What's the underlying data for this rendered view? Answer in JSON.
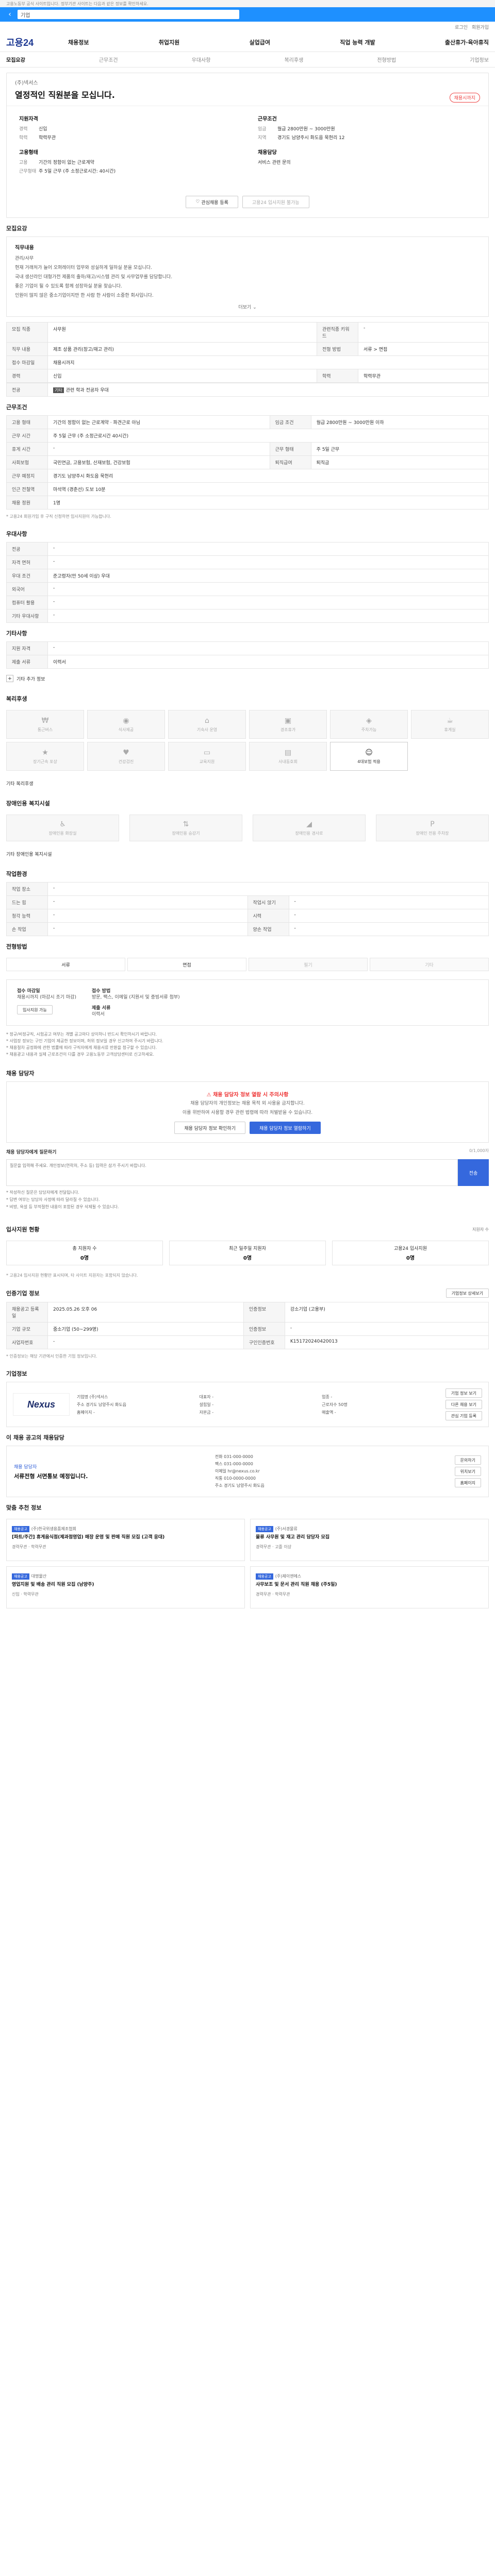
{
  "banner": "고용노동부 공식 사이트입니다. 정부기관 사이트는 다음과 같은 정보를 확인하세요.",
  "search": {
    "placeholder": "기업"
  },
  "top_links": [
    "로그인",
    "회원가입"
  ],
  "logo": "고용24",
  "gnb": [
    "채용정보",
    "취업지원",
    "실업급여",
    "직업 능력 개발",
    "출산휴가·육아휴직"
  ],
  "tabs": [
    "모집요강",
    "근무조건",
    "우대사항",
    "복리후생",
    "전형방법",
    "기업정보"
  ],
  "job": {
    "company": "(주)넥서스",
    "title": "열정적인 직원분을 모십니다.",
    "badge": "채용시까지"
  },
  "summary": {
    "qualifications_title": "지원자격",
    "career_k": "경력",
    "career_v": "신입",
    "education_k": "학력",
    "education_v": "학력무관",
    "conditions_title": "고용형태",
    "employment_k": "고용",
    "employment_v": "기간의 정함이 없는 근로계약",
    "worktype_k": "근무형태",
    "worktype_v": "주 5일 근무 (주 소정근로시간: 40시간)",
    "wage_title": "근무조건",
    "wage_k": "임금",
    "wage_v": "월급 2800만원 ~ 3000만원",
    "area_k": "지역",
    "area_v": "경기도 남양주시 화도읍 묵현리 12",
    "agency_title": "채용담당",
    "agency_v": "서비스 관련 문의",
    "btn_interest": "관심채용 등록",
    "btn_apply": "고용24 입사지원 불가능"
  },
  "recruit_title": "모집요강",
  "duties": {
    "heading": "직무내용",
    "sub": "관리/사무",
    "lines": [
      "현재 거래처가 늘어 오퍼레이터 업무와 성실하게 일하실 분을 모십니다.",
      "국내 생산라인 대형가전 제품의 출하/재고/시스템 관리 및 사무업무를 담당합니다.",
      "좋은 기업이 될 수 있도록 함께 성장하실 분을 찾습니다.",
      "인원이 많지 않은 중소기업이지만 한 사람 한 사람이 소중한 회사입니다."
    ],
    "more": "더보기"
  },
  "recruit_rows": [
    {
      "k": "모집 직종",
      "v": "사무원",
      "k2": "관련직종 키워드",
      "v2": "-"
    },
    {
      "k": "직무 내용",
      "v": "제조 상품 관리(창고/재고 관리)",
      "k2": "전형 방법",
      "v2": "서류 > 면접"
    },
    {
      "k": "접수 마감일",
      "v": "채용시까지",
      "k2": "",
      "v2": ""
    },
    {
      "k": "경력",
      "v": "신입",
      "k2": "학력",
      "v2": "학력무관"
    }
  ],
  "major": {
    "k": "전공",
    "tag": "기타",
    "v": "관련 학과 전공자 우대"
  },
  "work_title": "근무조건",
  "work_rows": [
    {
      "k": "고용 형태",
      "v": "기간의 정함이 없는 근로계약 · 파견근로 아님",
      "k2": "임금 조건",
      "v2": "월급 2800만원 ~ 3000만원 이하"
    },
    {
      "k": "근무 시간",
      "v": "주 5일 근무 (주 소정근로시간 40시간)",
      "k2": "",
      "v2": ""
    },
    {
      "k": "휴게 시간",
      "v": "-",
      "k2": "근무 형태",
      "v2": "주 5일 근무"
    },
    {
      "k": "사회보험",
      "v": "국민연금, 고용보험, 산재보험, 건강보험",
      "k2": "퇴직급여",
      "v2": "퇴직금"
    },
    {
      "k": "근무 예정지",
      "v": "경기도 남양주시 화도읍 묵현리",
      "k2": "",
      "v2": ""
    },
    {
      "k": "인근 전철역",
      "v": "마석역 (경춘선) 도보 10분",
      "k2": "",
      "v2": ""
    },
    {
      "k": "채용 정원",
      "v": "1명",
      "k2": "",
      "v2": ""
    }
  ],
  "work_note": "* 고용24 회원가입 후 구직 신청하면 입사지원이 가능합니다.",
  "pref_title": "우대사항",
  "pref_rows": [
    {
      "k": "전공",
      "v": "-"
    },
    {
      "k": "자격 면허",
      "v": "-"
    },
    {
      "k": "우대 조건",
      "v": "준고령자(만 50세 이상) 우대"
    },
    {
      "k": "외국어",
      "v": "-"
    },
    {
      "k": "컴퓨터 활용",
      "v": "-"
    },
    {
      "k": "기타 우대사항",
      "v": "-"
    }
  ],
  "etc_title": "기타사항",
  "etc_rows": [
    {
      "k": "지원 자격",
      "v": "-"
    },
    {
      "k": "제출 서류",
      "v": "이력서"
    }
  ],
  "etc_more": "기타 추가 정보",
  "welfare_title": "복리후생",
  "welfare_items": [
    {
      "icon": "money-icon",
      "glyph": "₩",
      "label": "통근버스",
      "on": false
    },
    {
      "icon": "meal-icon",
      "glyph": "◉",
      "label": "식사제공",
      "on": false
    },
    {
      "icon": "house-icon",
      "glyph": "⌂",
      "label": "기숙사 운영",
      "on": false
    },
    {
      "icon": "gift-icon",
      "glyph": "▣",
      "label": "경조휴가",
      "on": false
    },
    {
      "icon": "car-icon",
      "glyph": "◈",
      "label": "주차가능",
      "on": false
    },
    {
      "icon": "coffee-icon",
      "glyph": "☕",
      "label": "휴게실",
      "on": false
    },
    {
      "icon": "award-icon",
      "glyph": "★",
      "label": "장기근속 포상",
      "on": false
    },
    {
      "icon": "heart-icon",
      "glyph": "♥",
      "label": "건강검진",
      "on": false
    },
    {
      "icon": "laptop-icon",
      "glyph": "▭",
      "label": "교육지원",
      "on": false
    },
    {
      "icon": "building-icon",
      "glyph": "▤",
      "label": "사내동호회",
      "on": false
    },
    {
      "icon": "person-icon",
      "glyph": "☺",
      "label": "4대보험 적용",
      "on": true
    }
  ],
  "welfare_etc": "기타 복리후생",
  "disabled_title": "장애인용 복지시설",
  "disabled_items": [
    {
      "icon": "wheelchair-icon",
      "glyph": "♿",
      "label": "장애인용 화장실"
    },
    {
      "icon": "elevator-icon",
      "glyph": "⇅",
      "label": "장애인용 승강기"
    },
    {
      "icon": "ramp-icon",
      "glyph": "◢",
      "label": "장애인용 경사로"
    },
    {
      "icon": "parking-icon",
      "glyph": "P",
      "label": "장애인 전용 주차장"
    }
  ],
  "disabled_etc": "기타 장애인용 복지시설",
  "workenv_title": "작업환경",
  "workenv_rows": [
    {
      "k": "작업 장소",
      "v": "-",
      "k2": "",
      "v2": ""
    },
    {
      "k": "드는 힘",
      "v": "-",
      "k2": "작업시 앉기",
      "v2": "-"
    },
    {
      "k": "청각 능력",
      "v": "-",
      "k2": "시력",
      "v2": "-"
    },
    {
      "k": "손 작업",
      "v": "-",
      "k2": "양손 작업",
      "v2": "-"
    }
  ],
  "hiring_title": "전형방법",
  "hiring_steps": [
    {
      "label": "서류",
      "on": true
    },
    {
      "label": "면접",
      "on": true
    },
    {
      "label": "필기",
      "on": false
    },
    {
      "label": "기타",
      "on": false
    }
  ],
  "apply": {
    "deadline_k": "접수 마감일",
    "deadline_v": "채용시까지 (마감시 조기 마감)",
    "method_k": "접수 방법",
    "method_v": "방문, 팩스, 이메일 (지원서 및 증빙서류 첨부)",
    "email_k": "제출 서류",
    "email_v": "이력서",
    "btn": "입사지원 가능"
  },
  "apply_notes": [
    "* 정규/비정규직, 시험공고 여부는 개별 공고마다 상이하니 반드시 확인하시기 바랍니다.",
    "* 사업장 정보는 구인 기업이 제공한 정보이며, 허위 정보일 경우 신고하여 주시기 바랍니다.",
    "* 채용절차 공정화에 관한 법률에 따라 구직자에게 채용서류 반환을 청구할 수 있습니다.",
    "* 채용광고 내용과 실제 근로조건이 다를 경우 고용노동부 고객상담센터로 신고하세요."
  ],
  "contact_title": "채용 담당자",
  "contact": {
    "warn": "채용 담당자 정보 열람 시 주의사항",
    "p1": "채용 담당자의 개인정보는 채용 목적 외 사용을 금지합니다.",
    "p2": "이를 위반하여 사용할 경우 관련 법령에 따라 처벌받을 수 있습니다.",
    "btn1": "채용 담당자 정보 확인하기",
    "btn2": "채용 담당자 정보 열람하기"
  },
  "inquiry": {
    "label": "채용 담당자에게 질문하기",
    "right": "0/1,000자",
    "placeholder": "질문을 입력해 주세요. 개인정보(연락처, 주소 등) 입력은 삼가 주시기 바랍니다.",
    "send": "전송"
  },
  "inquiry_notes": [
    "* 작성하신 질문은 담당자에게 전달됩니다.",
    "* 답변 여부는 담당자 사정에 따라 달라질 수 있습니다.",
    "* 비방, 욕설 등 부적절한 내용이 포함된 경우 삭제될 수 있습니다."
  ],
  "status_title": "입사지원 현황",
  "status_right": "지원자 수",
  "stats": [
    {
      "k": "총 지원자 수",
      "v": "0명"
    },
    {
      "k": "최근 일주일 지원자",
      "v": "0명"
    },
    {
      "k": "고용24 입사지원",
      "v": "0명"
    }
  ],
  "status_note": "* 고용24 입사지원 현황만 표시되며, 타 사이트 지원자는 포함되지 않습니다.",
  "recruit_info_title": "인증기업 정보",
  "recruit_info_right": "기업정보 상세보기",
  "recruit_info_rows": [
    {
      "k": "채용공고 등록일",
      "v": "2025.05.26 오후 06",
      "k2": "인증정보",
      "v2": "강소기업 (고용부)"
    },
    {
      "k": "기업 규모",
      "v": "중소기업 (50~299명)",
      "k2": "인증정보",
      "v2": "-"
    },
    {
      "k": "사업자번호",
      "v": "-",
      "k2": "구인인증번호",
      "v2": "K151720240420013"
    }
  ],
  "recruit_info_note": "* 인증정보는 해당 기관에서 인증한 기업 정보입니다.",
  "company_title": "기업정보",
  "company": {
    "logo": "Nexus",
    "fields": [
      "기업명 (주)넥서스",
      "대표자 -",
      "업종 -",
      "주소 경기도 남양주시 화도읍",
      "설립일 -",
      "근로자수 50명",
      "홈페이지 -",
      "자본금 -",
      "매출액 -"
    ],
    "btn1": "기업 정보 보기",
    "btn2": "다른 채용 보기",
    "btn3": "관심 기업 등록"
  },
  "agent_title": "이 채용 공고의 채용담당",
  "agent": {
    "k": "채용 담당자",
    "v": "서류전형 서면통보 예정입니다.",
    "mid": [
      "전화 031-000-0000",
      "팩스 031-000-0000",
      "이메일 hr@nexus.co.kr",
      "직통 010-0000-0000",
      "주소 경기도 남양주시 화도읍"
    ],
    "btn1": "문의하기",
    "btn2": "위치보기",
    "btn3": "홈페이지"
  },
  "recommend_title": "맞춤 추천 정보",
  "recommend": [
    {
      "tag": "채용공고",
      "co": "(주)한국위생용품제조협회",
      "title": "[파트/주간] 휴게음식점(제과점영업) 매장 운영 및 판매 직원 모집 (고객 응대)",
      "meta": "경력무관 · 학력무관"
    },
    {
      "tag": "채용공고",
      "co": "(주)서경물류",
      "title": "물류 사무원 및 재고 관리 담당자 모집",
      "meta": "경력무관 · 고졸 이상"
    },
    {
      "tag": "채용공고",
      "co": "대명물산",
      "title": "영업지원 및 배송 관리 직원 모집 (남양주)",
      "meta": "신입 · 학력무관"
    },
    {
      "tag": "채용공고",
      "co": "(주)제이엔에스",
      "title": "사무보조 및 문서 관리 직원 채용 (주5일)",
      "meta": "경력무관 · 학력무관"
    }
  ]
}
